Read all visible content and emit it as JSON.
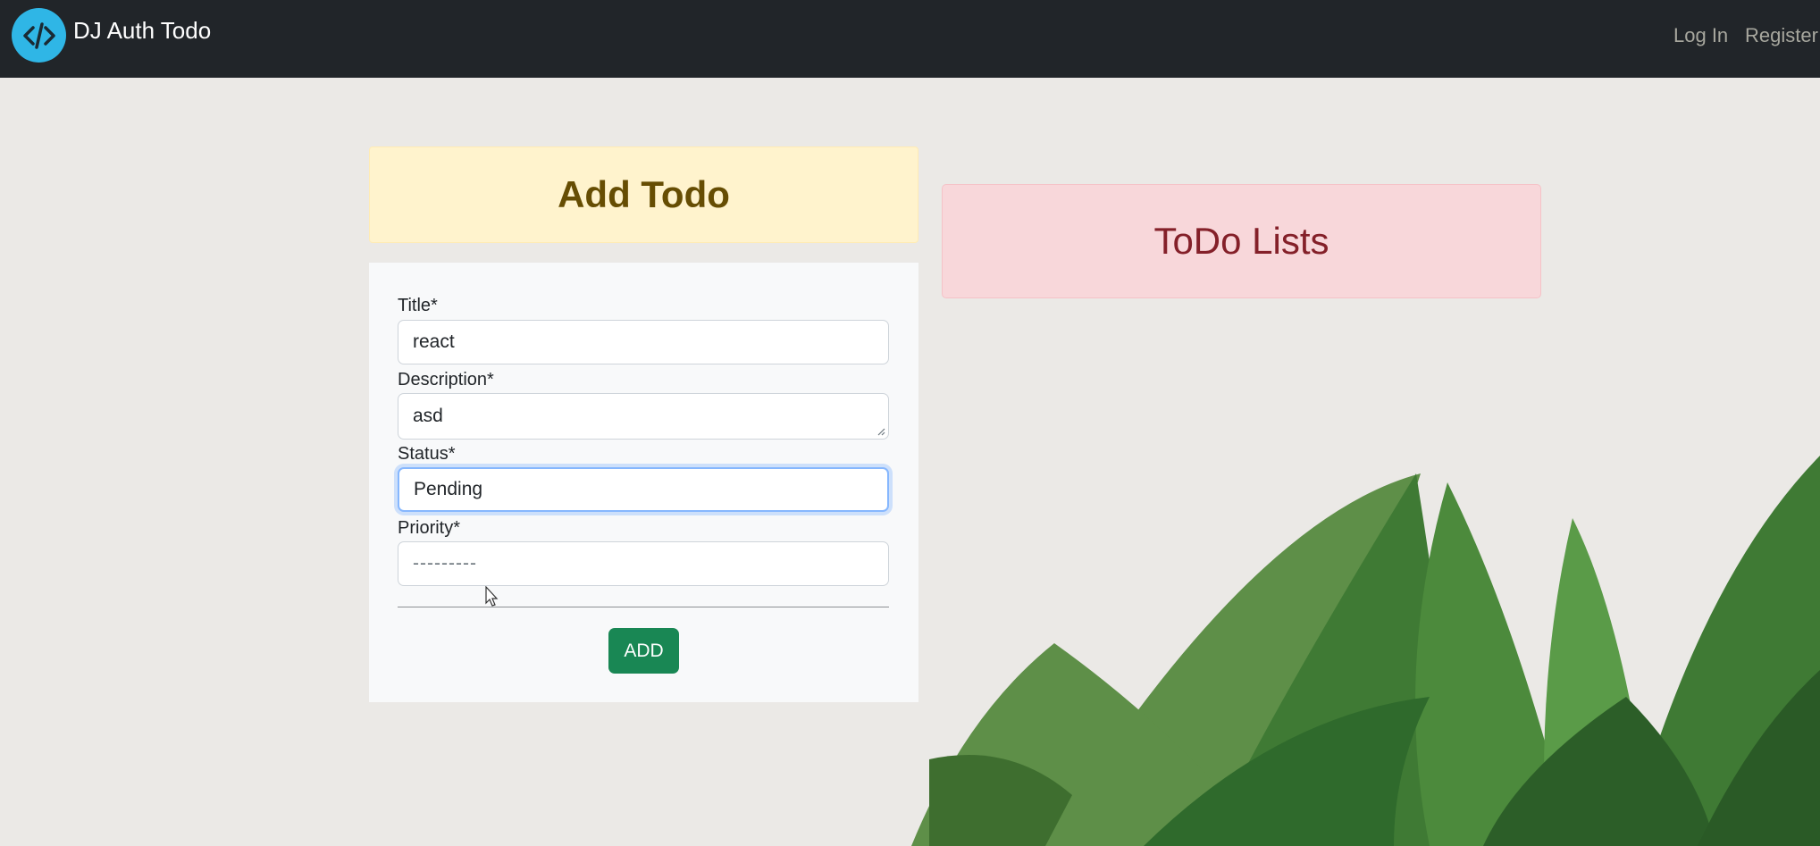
{
  "navbar": {
    "brand": "DJ Auth Todo",
    "logo_icon": "code-icon",
    "links": {
      "login": "Log In",
      "register": "Register"
    }
  },
  "add_todo": {
    "heading": "Add Todo",
    "fields": {
      "title": {
        "label": "Title*",
        "value": "react"
      },
      "description": {
        "label": "Description*",
        "value": "asd"
      },
      "status": {
        "label": "Status*",
        "value": "Pending"
      },
      "priority": {
        "label": "Priority*",
        "value": "---------"
      }
    },
    "submit_label": "ADD"
  },
  "todo_lists": {
    "heading": "ToDo Lists"
  },
  "colors": {
    "navbar": "#212529",
    "logo": "#2fb6e6",
    "add_button": "#198754",
    "warning_bg": "#fff3cd",
    "danger_bg": "#f8d7da"
  }
}
